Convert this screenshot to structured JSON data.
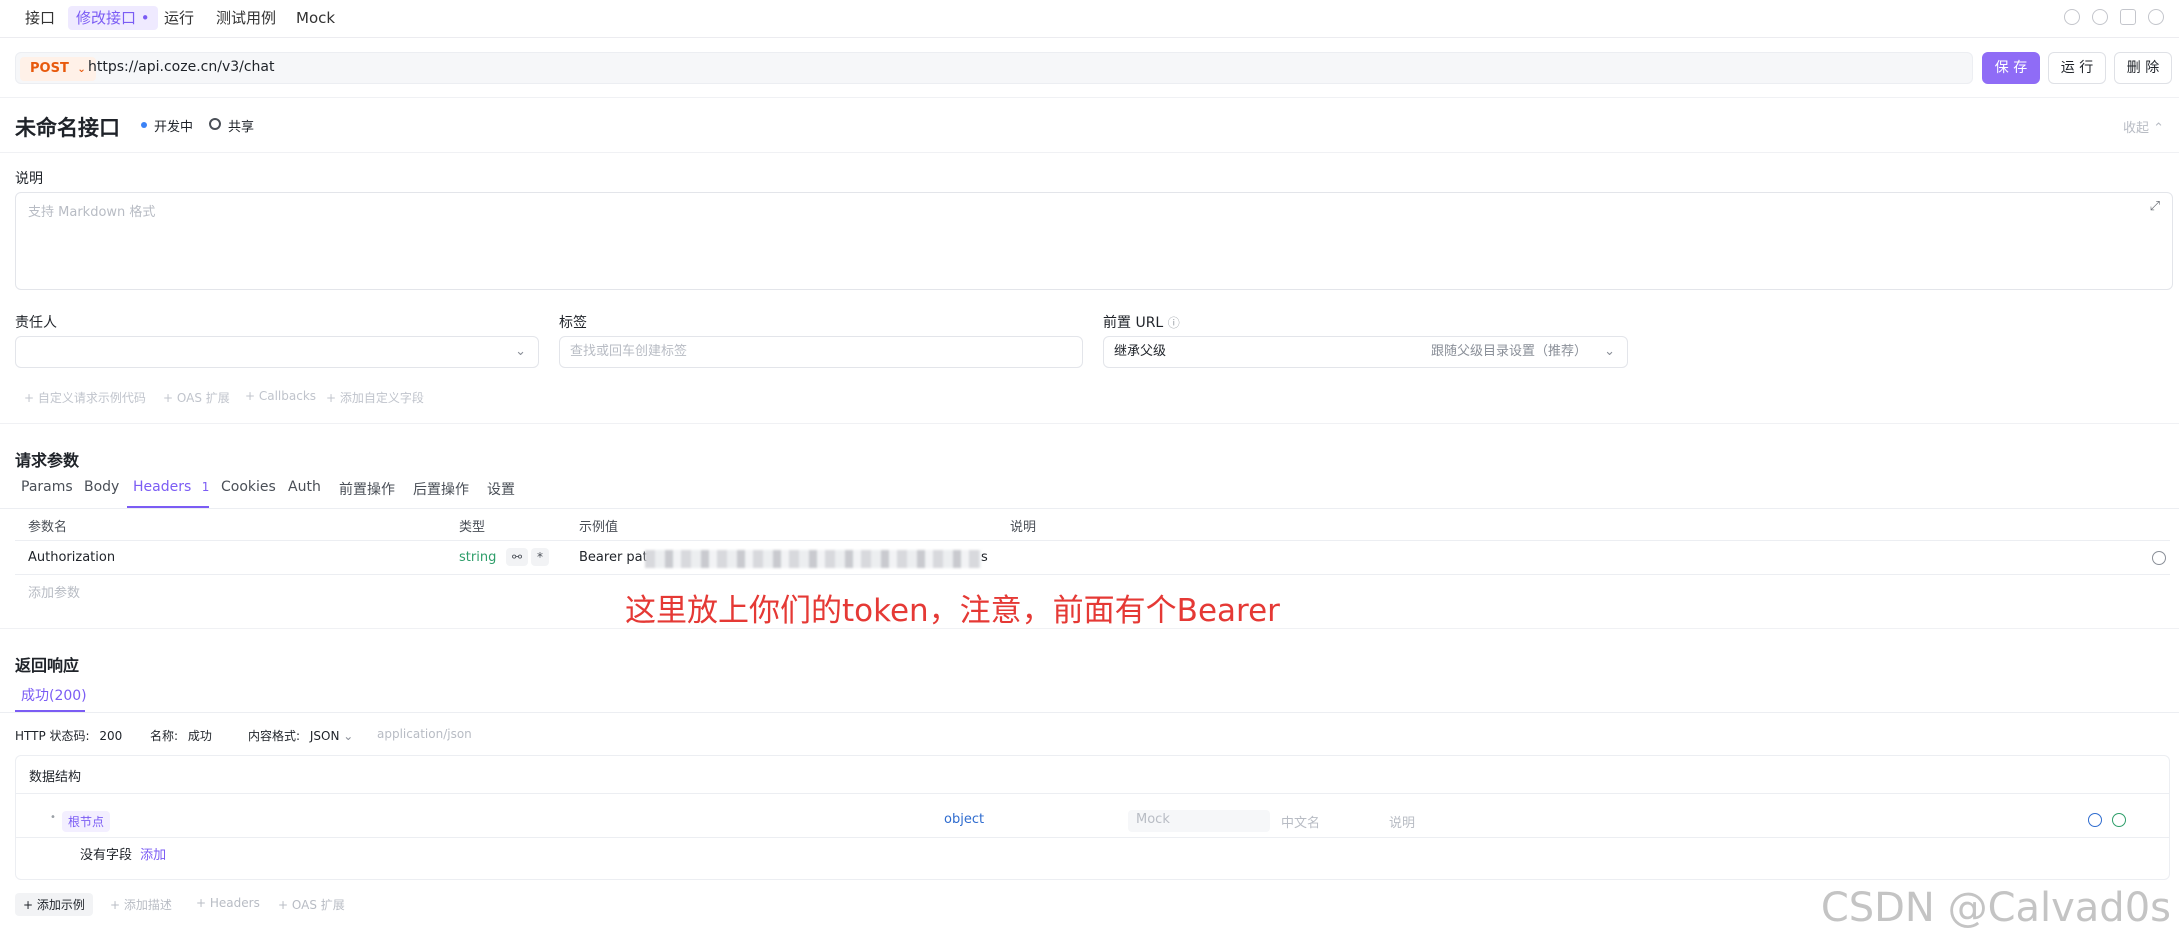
{
  "top_tabs": [
    "接口",
    "修改接口",
    "运行",
    "测试用例",
    "Mock"
  ],
  "request": {
    "method": "POST",
    "url": "https://api.coze.cn/v3/chat",
    "save_label": "保 存",
    "run_label": "运 行",
    "delete_label": "删 除"
  },
  "api": {
    "title": "未命名接口",
    "status": "开发中",
    "share": "共享",
    "collapse": "收起"
  },
  "description": {
    "label": "说明",
    "placeholder": "支持 Markdown 格式"
  },
  "owner": {
    "label": "责任人"
  },
  "tags": {
    "label": "标签",
    "placeholder": "查找或回车创建标签"
  },
  "prefix_url": {
    "label": "前置 URL",
    "value": "继承父级",
    "hint": "跟随父级目录设置（推荐）"
  },
  "extras": [
    "+ 自定义请求示例代码",
    "+ OAS 扩展",
    "+ Callbacks",
    "+ 添加自定义字段"
  ],
  "request_params": {
    "title": "请求参数",
    "tabs": [
      "Params",
      "Body",
      "Headers",
      "Cookies",
      "Auth",
      "前置操作",
      "后置操作",
      "设置"
    ],
    "headers_count": "1",
    "columns": [
      "参数名",
      "类型",
      "示例值",
      "说明"
    ],
    "rows": [
      {
        "name": "Authorization",
        "type": "string",
        "example_prefix": "Bearer pat",
        "example_suffix": "s"
      }
    ],
    "add_param": "添加参数"
  },
  "annotation": "这里放上你们的token，注意，前面有个Bearer",
  "response": {
    "title": "返回响应",
    "tab": "成功(200)",
    "http_code_label": "HTTP 状态码:",
    "http_code": "200",
    "name_label": "名称:",
    "name": "成功",
    "content_format_label": "内容格式:",
    "content_format": "JSON",
    "content_type": "application/json",
    "schema_title": "数据结构",
    "root_node": "根节点",
    "root_type": "object",
    "mock_placeholder": "Mock",
    "cn_name_placeholder": "中文名",
    "desc_placeholder": "说明",
    "no_field": "没有字段",
    "add_link": "添加"
  },
  "bottom_actions": [
    "+ 添加示例",
    "+ 添加描述",
    "+ Headers",
    "+ OAS 扩展"
  ],
  "watermark": "CSDN @Calvad0s",
  "colors": {
    "accent": "#7b5cf4",
    "method": "#e8590c",
    "annotation": "#e53935",
    "type": "#2e9e6a"
  }
}
